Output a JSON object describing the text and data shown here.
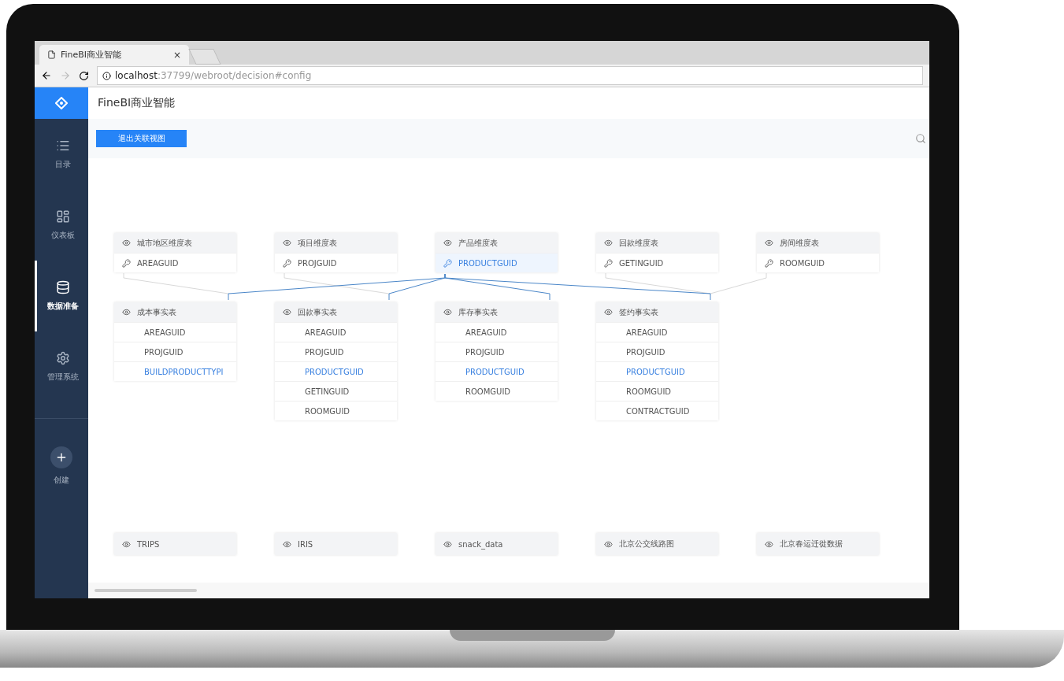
{
  "browser": {
    "tab_title": "FineBI商业智能",
    "tab_close": "×",
    "url_host": "localhost",
    "url_path": ":37799/webroot/decision#config"
  },
  "app": {
    "title": "FineBI商业智能",
    "exit_button": "退出关联视图"
  },
  "sidebar": {
    "items": [
      {
        "label": "目录",
        "selected": false
      },
      {
        "label": "仪表板",
        "selected": false
      },
      {
        "label": "数据准备",
        "selected": true
      },
      {
        "label": "管理系统",
        "selected": false
      }
    ],
    "create": "创建"
  },
  "dimension_tables": [
    {
      "name": "城市地区维度表",
      "key": "AREAGUID",
      "selected": false
    },
    {
      "name": "项目维度表",
      "key": "PROJGUID",
      "selected": false
    },
    {
      "name": "产品维度表",
      "key": "PRODUCTGUID",
      "selected": true
    },
    {
      "name": "回款维度表",
      "key": "GETINGUID",
      "selected": false
    },
    {
      "name": "房间维度表",
      "key": "ROOMGUID",
      "selected": false
    }
  ],
  "fact_tables": [
    {
      "name": "成本事实表",
      "fields": [
        {
          "name": "AREAGUID",
          "linked": false
        },
        {
          "name": "PROJGUID",
          "linked": false
        },
        {
          "name": "BUILDPRODUCTTYPI",
          "linked": true
        }
      ]
    },
    {
      "name": "回款事实表",
      "fields": [
        {
          "name": "AREAGUID",
          "linked": false
        },
        {
          "name": "PROJGUID",
          "linked": false
        },
        {
          "name": "PRODUCTGUID",
          "linked": true
        },
        {
          "name": "GETINGUID",
          "linked": false
        },
        {
          "name": "ROOMGUID",
          "linked": false
        }
      ]
    },
    {
      "name": "库存事实表",
      "fields": [
        {
          "name": "AREAGUID",
          "linked": false
        },
        {
          "name": "PROJGUID",
          "linked": false
        },
        {
          "name": "PRODUCTGUID",
          "linked": true
        },
        {
          "name": "ROOMGUID",
          "linked": false
        }
      ]
    },
    {
      "name": "签约事实表",
      "fields": [
        {
          "name": "AREAGUID",
          "linked": false
        },
        {
          "name": "PROJGUID",
          "linked": false
        },
        {
          "name": "PRODUCTGUID",
          "linked": true
        },
        {
          "name": "ROOMGUID",
          "linked": false
        },
        {
          "name": "CONTRACTGUID",
          "linked": false
        }
      ]
    }
  ],
  "other_tables": [
    "TRIPS",
    "IRIS",
    "snack_data",
    "北京公交线路图",
    "北京春运迁徙数据"
  ]
}
